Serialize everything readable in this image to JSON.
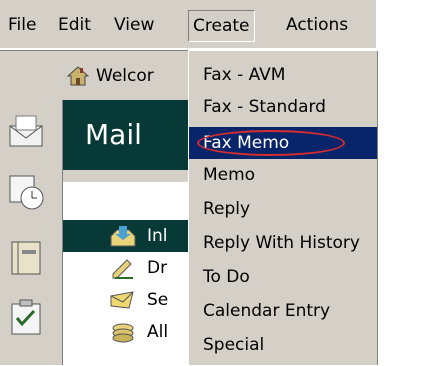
{
  "menubar": {
    "items": [
      {
        "label": "File"
      },
      {
        "label": "Edit"
      },
      {
        "label": "View"
      },
      {
        "label": "Create"
      },
      {
        "label": "Actions"
      }
    ]
  },
  "welcome": {
    "text": "Welcor"
  },
  "mail": {
    "title": "Mail",
    "folders": [
      {
        "label": "Inl",
        "icon": "inbox-icon",
        "selected": true
      },
      {
        "label": "Dr",
        "icon": "drafts-icon"
      },
      {
        "label": "Se",
        "icon": "sent-icon"
      },
      {
        "label": "All",
        "icon": "all-documents-icon"
      }
    ]
  },
  "create_menu": {
    "items": [
      {
        "label": "Fax - AVM"
      },
      {
        "label": "Fax - Standard"
      },
      {
        "label": "Fax Memo",
        "highlighted": true
      },
      {
        "label": "Memo"
      },
      {
        "label": "Reply"
      },
      {
        "label": "Reply With History"
      },
      {
        "label": "To Do"
      },
      {
        "label": "Calendar Entry"
      },
      {
        "label": "Special"
      }
    ]
  },
  "colors": {
    "menu_bg": "#d4d0c8",
    "highlight": "#08246b",
    "mail_header": "#073a36",
    "annotation": "#d62d2d"
  }
}
